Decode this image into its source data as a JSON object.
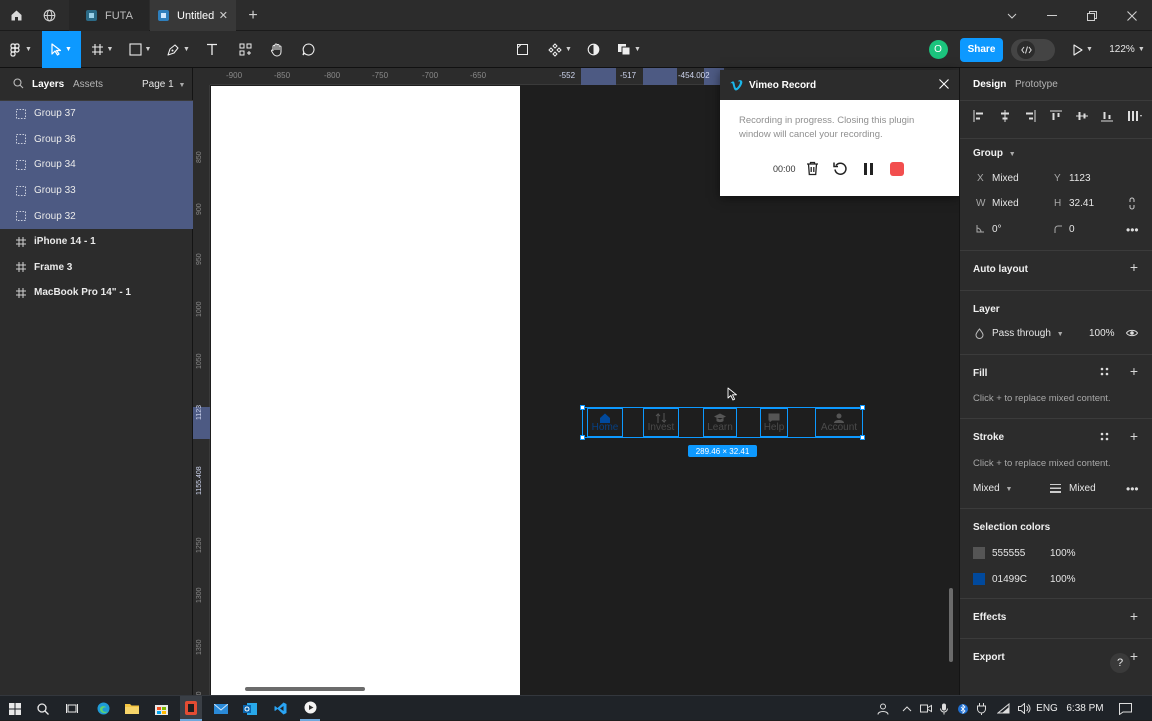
{
  "tabs": [
    {
      "label": "FUTA"
    },
    {
      "label": "Untitled"
    }
  ],
  "left_panel": {
    "tabs": [
      "Layers",
      "Assets"
    ],
    "page": "Page 1",
    "layers": [
      {
        "label": "Group 37",
        "type": "group",
        "selected": true
      },
      {
        "label": "Group 36",
        "type": "group",
        "selected": true
      },
      {
        "label": "Group 34",
        "type": "group",
        "selected": true
      },
      {
        "label": "Group 33",
        "type": "group",
        "selected": true
      },
      {
        "label": "Group 32",
        "type": "group",
        "selected": true
      },
      {
        "label": "iPhone 14 - 1",
        "type": "frame",
        "selected": false
      },
      {
        "label": "Frame 3",
        "type": "frame",
        "selected": false
      },
      {
        "label": "MacBook Pro 14\" - 1",
        "type": "frame",
        "selected": false
      }
    ]
  },
  "toolbar": {
    "share_label": "Share",
    "zoom": "122%",
    "avatar_initial": "O"
  },
  "ruler_top": [
    "-900",
    "-850",
    "-800",
    "-750",
    "-700",
    "-650",
    "-552",
    "-517",
    "-454.002"
  ],
  "ruler_left": [
    "850",
    "900",
    "950",
    "1000",
    "1050",
    "1123",
    "1155.408",
    "1250",
    "1300",
    "1350",
    "1400"
  ],
  "canvas": {
    "selection_size": "289.46 × 32.41",
    "nav_items": [
      "Home",
      "Invest",
      "Learn",
      "Help",
      "Account"
    ]
  },
  "plugin": {
    "title": "Vimeo Record",
    "message": "Recording in progress. Closing this plugin window will cancel your recording.",
    "timer": "00:00"
  },
  "right_panel": {
    "tabs": [
      "Design",
      "Prototype"
    ],
    "group_label": "Group",
    "x_label": "X",
    "x_value": "Mixed",
    "y_label": "Y",
    "y_value": "1123",
    "w_label": "W",
    "w_value": "Mixed",
    "h_label": "H",
    "h_value": "32.41",
    "rotation": "0°",
    "radius": "0",
    "auto_layout": "Auto layout",
    "layer_title": "Layer",
    "blend": "Pass through",
    "opacity": "100%",
    "fill_title": "Fill",
    "fill_note": "Click + to replace mixed content.",
    "stroke_title": "Stroke",
    "stroke_note": "Click + to replace mixed content.",
    "stroke_mixed": "Mixed",
    "stroke_weight": "Mixed",
    "selection_colors_title": "Selection colors",
    "selection_colors": [
      {
        "hex": "555555",
        "opacity": "100%",
        "color": "#555555"
      },
      {
        "hex": "01499C",
        "opacity": "100%",
        "color": "#01499C"
      }
    ],
    "effects_title": "Effects",
    "export_title": "Export",
    "help": "?"
  },
  "taskbar": {
    "lang": "ENG",
    "time": "6:38 PM"
  },
  "colors": {
    "accent": "#0d99ff",
    "selected_layer": "#4d5a83",
    "record_red": "#f24e4e",
    "avatar_green": "#1bc47d"
  }
}
